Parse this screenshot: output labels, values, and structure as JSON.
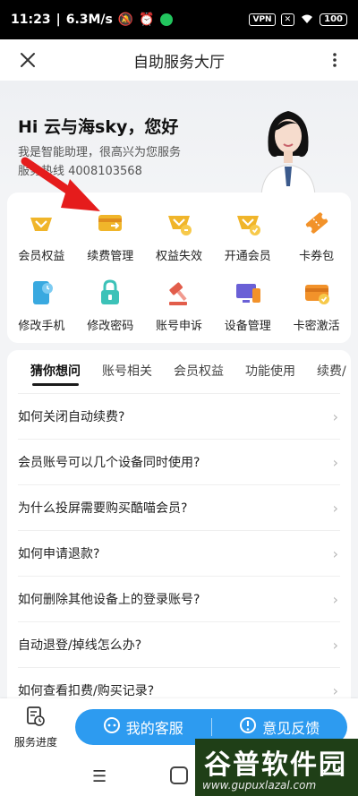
{
  "status_bar": {
    "time": "11:23",
    "speed": "6.3M/s",
    "vpn": "VPN",
    "battery": "100"
  },
  "header": {
    "title": "自助服务大厅",
    "close_icon": "close-icon",
    "more_icon": "more-vertical-icon"
  },
  "hero": {
    "greeting": "Hi 云与海sky，您好",
    "intro": "我是智能助理，很高兴为您服务",
    "hotline": "服务热线 4008103568"
  },
  "services": {
    "items": [
      {
        "label": "会员权益",
        "icon": "crown-icon",
        "color": "#f0b52a"
      },
      {
        "label": "续费管理",
        "icon": "card-renew-icon",
        "color": "#f0b52a"
      },
      {
        "label": "权益失效",
        "icon": "crown-broken-icon",
        "color": "#f0b52a"
      },
      {
        "label": "开通会员",
        "icon": "crown-check-icon",
        "color": "#f0b52a"
      },
      {
        "label": "卡券包",
        "icon": "ticket-icon",
        "color": "#f2922a"
      },
      {
        "label": "修改手机",
        "icon": "phone-icon",
        "color": "#39a9e0"
      },
      {
        "label": "修改密码",
        "icon": "lock-icon",
        "color": "#3cc2b8"
      },
      {
        "label": "账号申诉",
        "icon": "gavel-icon",
        "color": "#e25d4b"
      },
      {
        "label": "设备管理",
        "icon": "device-icon",
        "color": "#6a60d6"
      },
      {
        "label": "卡密激活",
        "icon": "card-check-icon",
        "color": "#f2922a"
      }
    ]
  },
  "faq": {
    "tabs": [
      "猜你想问",
      "账号相关",
      "会员权益",
      "功能使用",
      "续费/"
    ],
    "active_tab": 0,
    "questions": [
      "如何关闭自动续费?",
      "会员账号可以几个设备同时使用?",
      "为什么投屏需要购买酷喵会员?",
      "如何申请退款?",
      "如何删除其他设备上的登录账号?",
      "自动退登/掉线怎么办?",
      "如何查看扣费/购买记录?"
    ]
  },
  "bottom": {
    "progress_label": "服务进度",
    "service_label": "我的客服",
    "feedback_label": "意见反馈",
    "accent": "#2d9bf0"
  },
  "watermark": {
    "title": "谷普软件园",
    "url": "www.gupuxlazal.com"
  }
}
